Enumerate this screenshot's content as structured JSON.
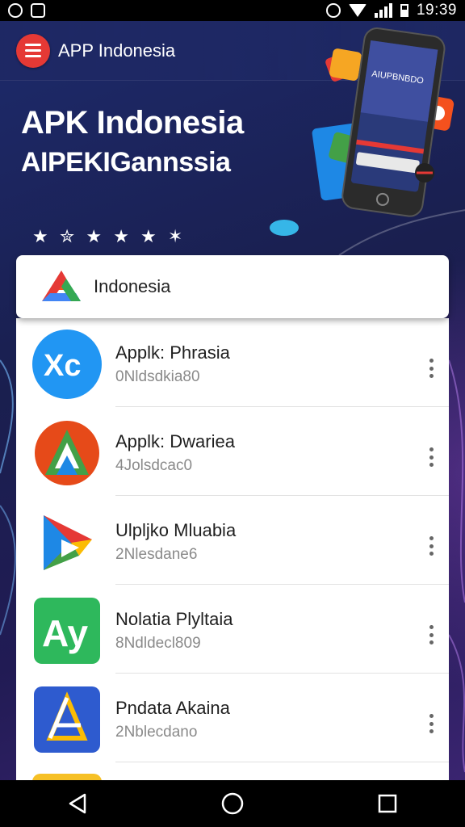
{
  "status_bar": {
    "time": "19:39",
    "left_icons": [
      "screenshot-icon",
      "image-icon"
    ],
    "right_icons": [
      "alarm-icon",
      "wifi-icon",
      "signal-icon",
      "battery-icon"
    ]
  },
  "app_bar": {
    "title": "APP Indonesia",
    "menu_icon": "hamburger-menu-icon",
    "accent_color": "#e53935"
  },
  "hero": {
    "headline": "APK Indonesia",
    "subheadline": "AIPEKIGannssia",
    "rating_stars": "★ ✮ ★ ★ ★ ✶"
  },
  "search": {
    "icon": "drive-triangle-icon",
    "text": "Indonesia"
  },
  "apps": [
    {
      "name": "Applk: Phrasia",
      "sub": "0Nldsdkia80",
      "icon": "blue-circle-app-icon",
      "color": "#2196f3"
    },
    {
      "name": "Applk: Dwariea",
      "sub": "4Jolsdcac0",
      "icon": "red-green-circle-app-icon",
      "color": "#e64a19"
    },
    {
      "name": "Ulpljko Mluabia",
      "sub": "2Nlesdane6",
      "icon": "play-store-app-icon",
      "color": "#e53935"
    },
    {
      "name": "Nolatia Plyltaia",
      "sub": "8Ndldecl809",
      "icon": "green-square-app-icon",
      "color": "#2eb85c"
    },
    {
      "name": "Pndata Akaina",
      "sub": "2Nblecdano",
      "icon": "blue-square-app-icon",
      "color": "#2e5bcf"
    }
  ],
  "nav_bar": {
    "back": "back-triangle-icon",
    "home": "home-circle-icon",
    "recents": "recents-square-icon"
  }
}
